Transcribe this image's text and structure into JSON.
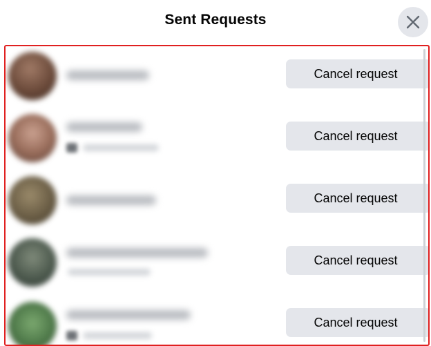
{
  "dialog": {
    "title": "Sent Requests",
    "close_icon": "close-icon"
  },
  "requests": [
    {
      "button_label": "Cancel request",
      "avatar_color": "#6b4a3a",
      "has_subtitle": false
    },
    {
      "button_label": "Cancel request",
      "avatar_color": "#9a6e5c",
      "has_subtitle": true
    },
    {
      "button_label": "Cancel request",
      "avatar_color": "#6a5d45",
      "has_subtitle": false
    },
    {
      "button_label": "Cancel request",
      "avatar_color": "#4d5a4e",
      "has_subtitle": true
    },
    {
      "button_label": "Cancel request",
      "avatar_color": "#4f7a4a",
      "has_subtitle": true
    }
  ],
  "colors": {
    "frame_border": "#e02020",
    "button_bg": "#e4e6eb",
    "text": "#050505"
  }
}
